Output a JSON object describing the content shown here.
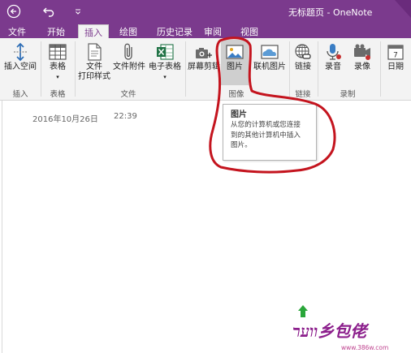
{
  "titlebar": {
    "title": "无标题页 - OneNote",
    "back_icon": "back-arrow-icon",
    "undo_icon": "undo-icon",
    "customize_icon": "customize-dropdown-icon"
  },
  "tabs": [
    {
      "label": "文件"
    },
    {
      "label": "开始"
    },
    {
      "label": "插入"
    },
    {
      "label": "绘图"
    },
    {
      "label": "历史记录"
    },
    {
      "label": "审阅"
    },
    {
      "label": "视图"
    }
  ],
  "active_tab": "插入",
  "ribbon": {
    "buttons": {
      "insert_space": "插入空间",
      "table": "表格",
      "file_printout_1": "文件",
      "file_printout_2": "打印样式",
      "file_attachment": "文件附件",
      "spreadsheet": "电子表格",
      "screen_clipping": "屏幕剪辑",
      "pictures": "图片",
      "online_pictures": "联机图片",
      "link": "链接",
      "audio": "录音",
      "video": "录像",
      "date": "日期"
    },
    "groups": {
      "insert": "插入",
      "tables": "表格",
      "files": "文件",
      "images": "图像",
      "links": "链接",
      "recording": "录制"
    },
    "calendar_day": "7"
  },
  "page": {
    "date": "2016年10月26日",
    "time": "22:39"
  },
  "tooltip": {
    "title": "图片",
    "line1": "从您的计算机或您连接",
    "line2": "到的其他计算机中插入",
    "line3": "图片。"
  },
  "watermark": {
    "text": "ווער乡包佬",
    "site": "www.386w.com"
  },
  "colors": {
    "brand": "#7b3a8d",
    "ribbon_bg": "#f3f3f3",
    "annotation": "#c4141e",
    "watermark": "#8c1f8c"
  }
}
